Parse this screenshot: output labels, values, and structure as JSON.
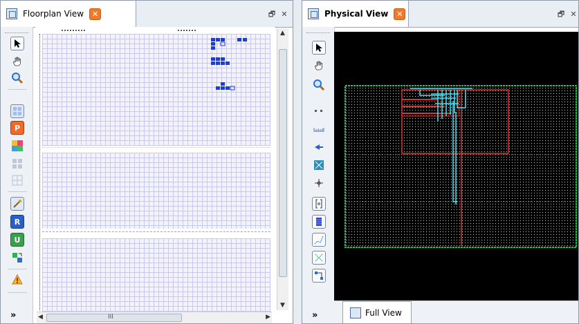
{
  "floorplan": {
    "tab_title": "Floorplan View",
    "close_glyph": "✕",
    "restore_glyph": "🗗",
    "close_panel_glyph": "✕",
    "more_glyph": "»",
    "hscroll_center": "III",
    "icons": [
      "pointer-icon",
      "hand-pan-icon",
      "zoom-icon",
      "grid-icon",
      "placement-icon",
      "color-map-icon",
      "grid-small-icon",
      "grid-select-icon",
      "tools-icon",
      "route-r-icon",
      "route-u-icon",
      "cell-move-icon",
      "warning-icon"
    ]
  },
  "physical": {
    "tab_title": "Physical View",
    "close_glyph": "✕",
    "restore_glyph": "🗗",
    "close_panel_glyph": "✕",
    "more_glyph": "»",
    "bottom_tab_label": "Full View",
    "icons": [
      "pointer-icon",
      "hand-pan-icon",
      "zoom-icon",
      "dots-icon",
      "ruler-icon",
      "arrow-left-icon",
      "net-icon",
      "crosshair-icon",
      "bracket-icon",
      "cell-icon",
      "route-icon",
      "move-icon",
      "connect-icon"
    ]
  },
  "colors": {
    "accent_close": "#f07a2a",
    "grid_line": "#c8c7ee",
    "selected_cells": "#1a3fd6",
    "die_border": "#21c24a",
    "region_red": "#e03030",
    "net_cyan": "#4ee0f0"
  }
}
